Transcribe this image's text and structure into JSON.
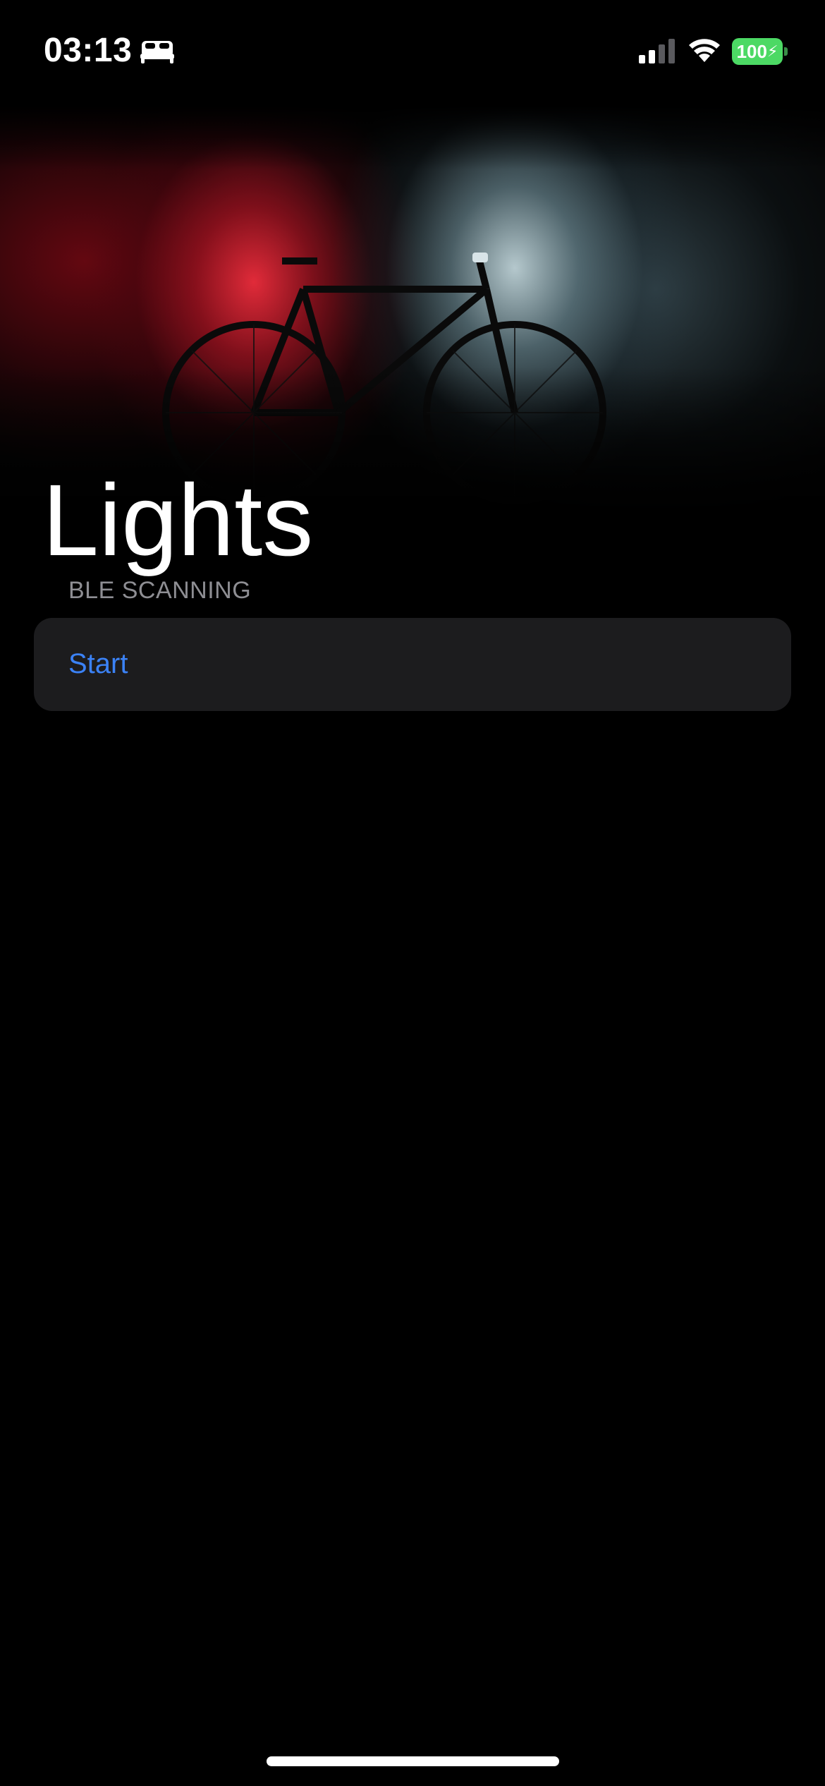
{
  "status_bar": {
    "time": "03:13",
    "battery_level": "100",
    "icons": [
      "sleep-focus-icon",
      "cellular-signal-icon",
      "wifi-icon",
      "battery-charging-icon"
    ],
    "battery_color": "#4cd964"
  },
  "header": {
    "title": "Lights"
  },
  "section": {
    "header": "BLE SCANNING",
    "cell_label": "Start"
  },
  "colors": {
    "accent": "#3b82f6",
    "cell_background": "#1c1c1e",
    "secondary_text": "#8e8e93"
  }
}
